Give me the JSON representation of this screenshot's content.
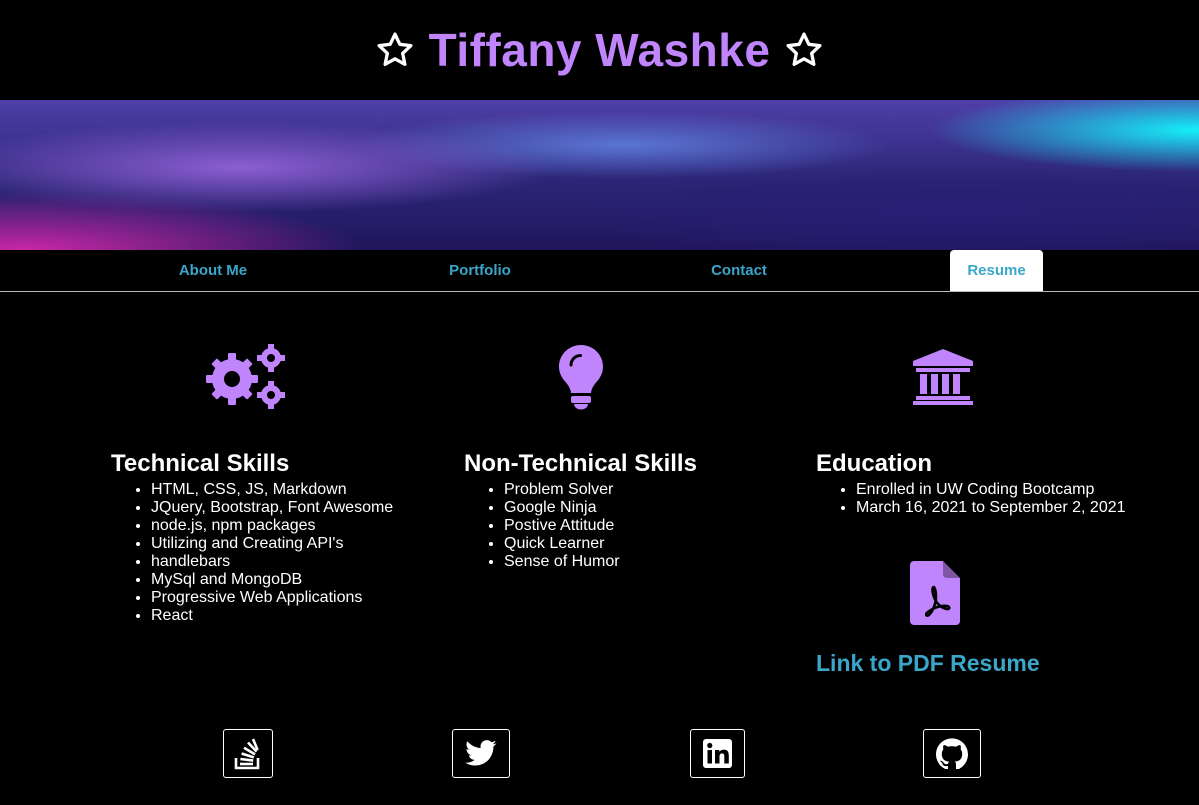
{
  "header": {
    "title": "Tiffany Washke",
    "left_icon": "star-icon",
    "right_icon": "star-icon"
  },
  "nav": {
    "items": [
      {
        "label": "About Me",
        "active": false
      },
      {
        "label": "Portfolio",
        "active": false
      },
      {
        "label": "Contact",
        "active": false
      },
      {
        "label": "Resume",
        "active": true
      }
    ]
  },
  "sections": {
    "technical": {
      "icon": "gears-icon",
      "title": "Technical Skills",
      "items": [
        "HTML, CSS, JS, Markdown",
        "JQuery, Bootstrap, Font Awesome",
        "node.js, npm packages",
        "Utilizing and Creating API's",
        "handlebars",
        "MySql and MongoDB",
        "Progressive Web Applications",
        "React"
      ]
    },
    "nontechnical": {
      "icon": "lightbulb-icon",
      "title": "Non-Technical Skills",
      "items": [
        "Problem Solver",
        "Google Ninja",
        "Postive Attitude",
        "Quick Learner",
        "Sense of Humor"
      ]
    },
    "education": {
      "icon": "university-icon",
      "title": "Education",
      "items": [
        "Enrolled in UW Coding Bootcamp",
        "March 16, 2021 to September 2, 2021"
      ]
    },
    "resume": {
      "icon": "pdf-file-icon",
      "link_label": "Link to PDF Resume"
    }
  },
  "social": [
    {
      "icon": "stack-overflow-icon"
    },
    {
      "icon": "twitter-icon"
    },
    {
      "icon": "linkedin-icon"
    },
    {
      "icon": "github-icon"
    }
  ],
  "colors": {
    "accent_purple": "#c084fc",
    "link_blue": "#3aa6c9",
    "background": "#000000"
  }
}
